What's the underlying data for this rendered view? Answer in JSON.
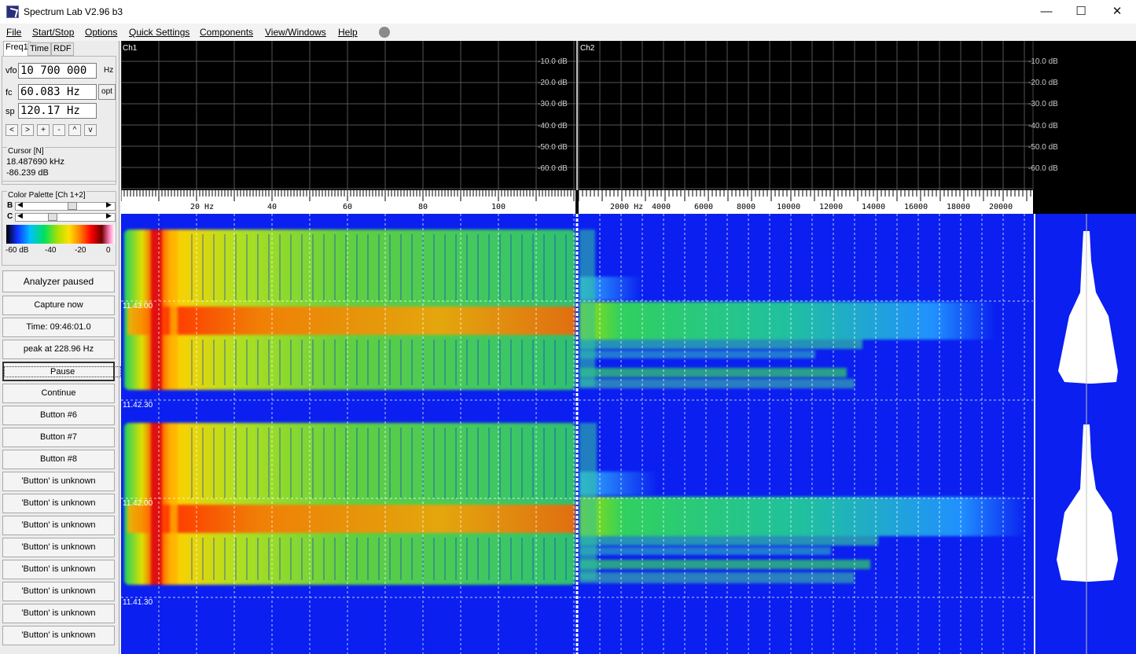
{
  "window": {
    "title": "Spectrum Lab V2.96 b3",
    "minimize": "—",
    "maximize": "☐",
    "close": "✕"
  },
  "menu": [
    "File",
    "Start/Stop",
    "Options",
    "Quick Settings",
    "Components",
    "View/Windows",
    "Help"
  ],
  "tabs": [
    "Freq1",
    "Time",
    "RDF"
  ],
  "freq": {
    "vfo_label": "vfo",
    "vfo_value": "10 700 000",
    "vfo_unit": "Hz",
    "fc_label": "fc",
    "fc_value": "60.083 Hz",
    "opt_label": "opt",
    "sp_label": "sp",
    "sp_value": "120.17 Hz",
    "nav_buttons": [
      "<",
      ">",
      "+",
      "-",
      "^",
      "v"
    ]
  },
  "cursor": {
    "title": "Cursor [N]",
    "freq": "18.487690 kHz",
    "level": "-86.239 dB"
  },
  "palette": {
    "title": "Color Palette [Ch 1+2]",
    "b_label": "B",
    "c_label": "C",
    "b_level": 0.55,
    "c_level": 0.3,
    "ticks": [
      "-60 dB",
      "-40",
      "-20",
      "0"
    ]
  },
  "buttons": {
    "analyzer": "Analyzer paused",
    "capture": "Capture now",
    "time": "Time:  09:46:01.0",
    "peak": "peak at 228.96 Hz",
    "pause": "Pause",
    "continue": "Continue",
    "b6": "Button #6",
    "b7": "Button #7",
    "b8": "Button #8",
    "unknown": [
      "'Button' is unknown",
      "'Button' is unknown",
      "'Button' is unknown",
      "'Button' is unknown",
      "'Button' is unknown",
      "'Button' is unknown",
      "'Button' is unknown",
      "'Button' is unknown"
    ]
  },
  "spectrum": {
    "ch1": "Ch1",
    "ch2": "Ch2",
    "db_labels": [
      "-10.0 dB",
      "-20.0 dB",
      "-30.0 dB",
      "-40.0 dB",
      "-50.0 dB",
      "-60.0 dB"
    ]
  },
  "scale": {
    "ch1_ticks": [
      "20 Hz",
      "40",
      "60",
      "80",
      "100"
    ],
    "ch2_ticks": [
      "2000 Hz",
      "4000",
      "6000",
      "8000",
      "10000",
      "12000",
      "14000",
      "16000",
      "18000",
      "20000"
    ]
  },
  "waterfall": {
    "times": [
      "11.43.00",
      "11.42.30",
      "11.42.00",
      "11.41.30"
    ]
  },
  "colors": {
    "waterfall_bg": "#0a1ff0",
    "spectrum_bg": "#000000"
  }
}
